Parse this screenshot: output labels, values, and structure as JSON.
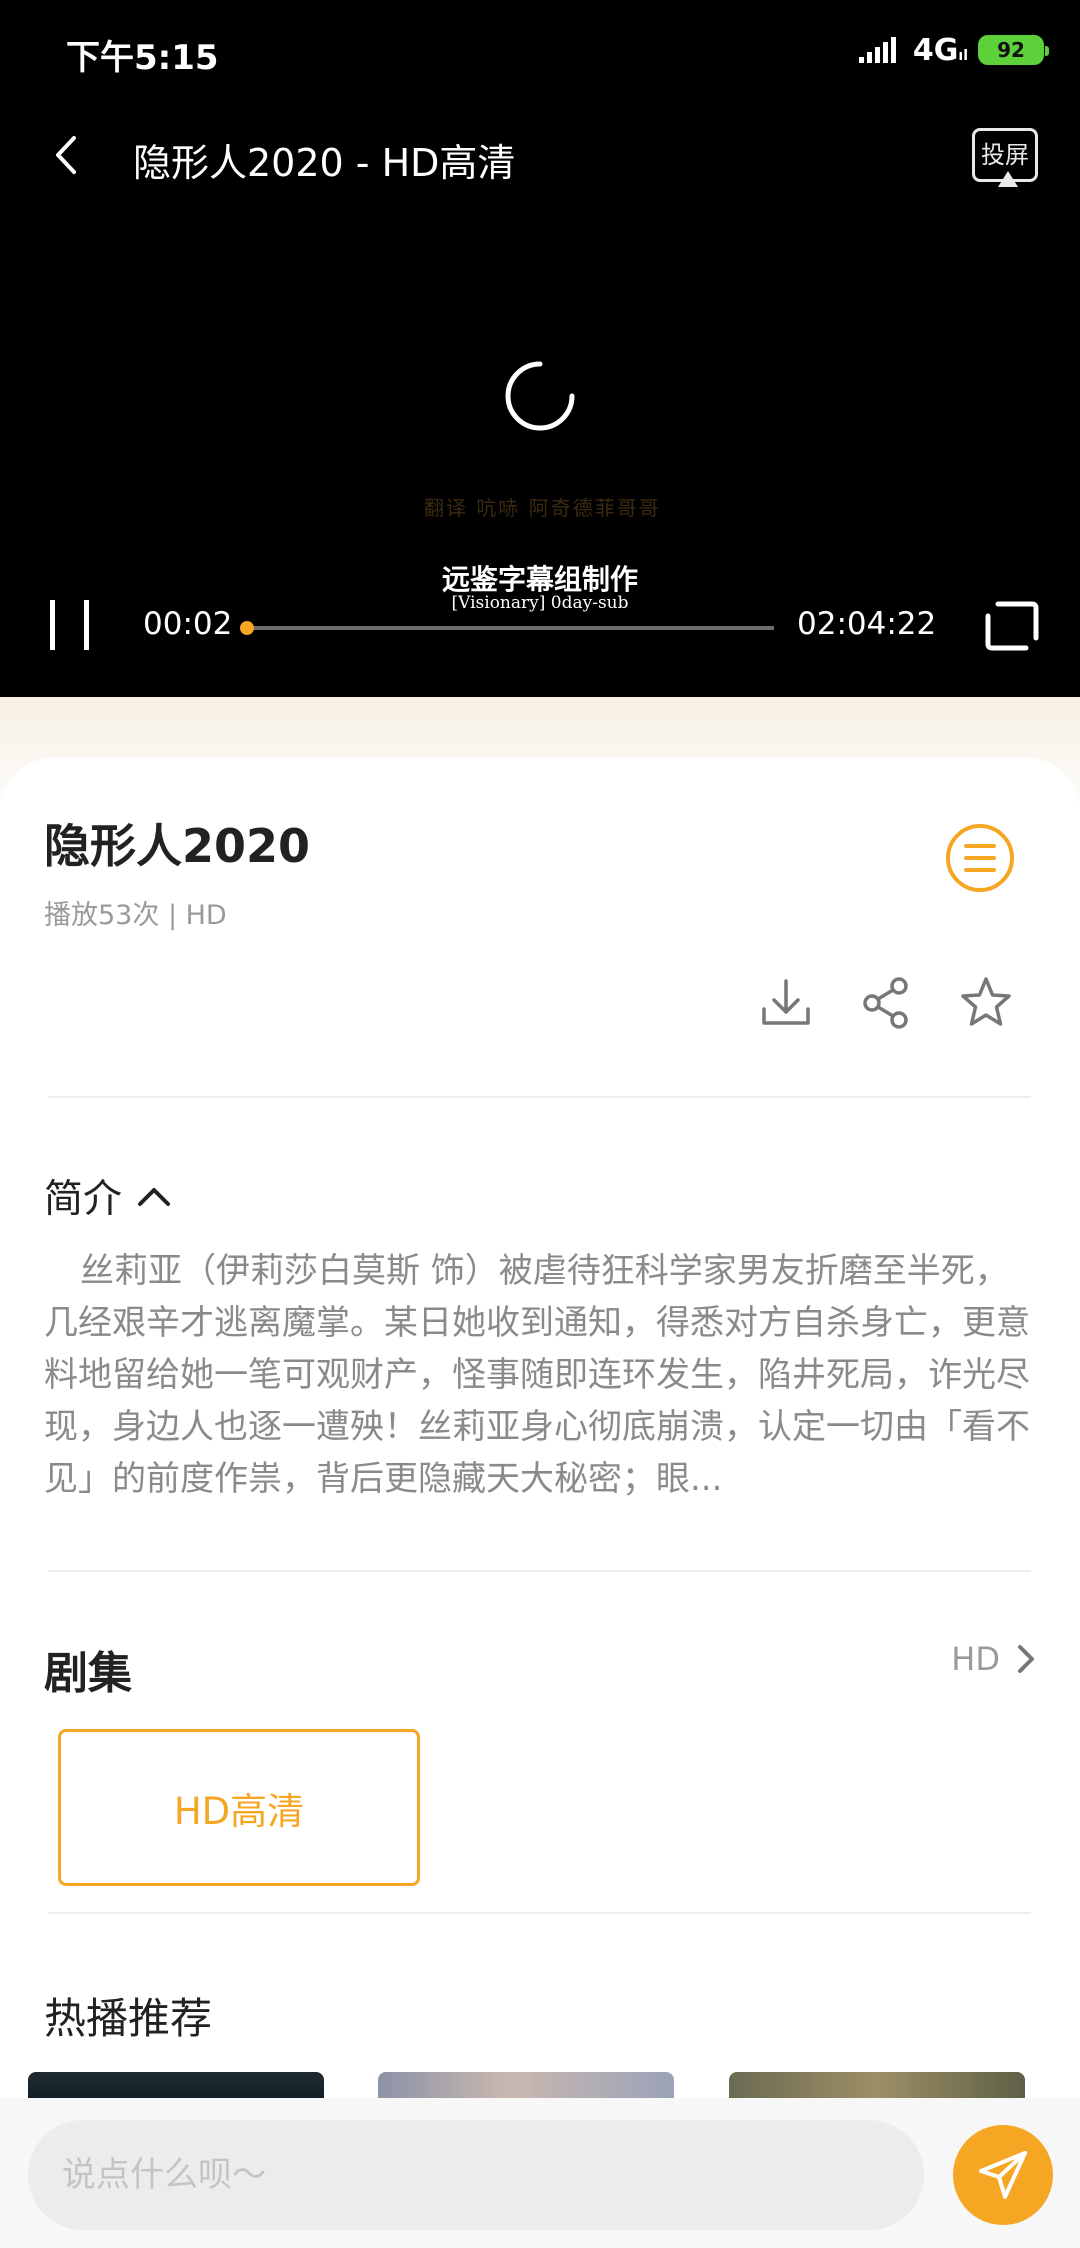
{
  "status_bar": {
    "time": "下午5:15",
    "network": "4G",
    "network_sub": "ıl",
    "battery": "92"
  },
  "player": {
    "title": "隐形人2020 - HD高清",
    "cast_label": "投屏",
    "subtitle_faded": "翻译 吭哧 阿奇德菲哥哥",
    "subtitle_main": "远鉴字幕组制作",
    "subtitle_small": "[Visionary] 0day-sub",
    "current_time": "00:02",
    "total_time": "02:04:22",
    "progress_fraction": 0.0003,
    "accent_color": "#f5a623"
  },
  "movie": {
    "title": "隐形人2020",
    "meta": "播放53次 | HD",
    "actions": [
      "download-icon",
      "share-icon",
      "star-icon"
    ]
  },
  "intro": {
    "heading": "简介",
    "text": "丝莉亚（伊莉莎白莫斯 饰）被虐待狂科学家男友折磨至半死，几经艰辛才逃离魔掌。某日她收到通知，得悉对方自杀身亡，更意料地留给她一笔可观财产，怪事随即连环发生，陷井死局，诈光尽现，身边人也逐一遭殃！丝莉亚身心彻底崩溃，认定一切由「看不见」的前度作祟，背后更隐藏天大秘密；眼..."
  },
  "episodes": {
    "heading": "剧集",
    "more_label": "HD",
    "items": [
      "HD高清"
    ]
  },
  "recommend": {
    "heading": "热播推荐"
  },
  "comment": {
    "placeholder": "说点什么呗～"
  }
}
